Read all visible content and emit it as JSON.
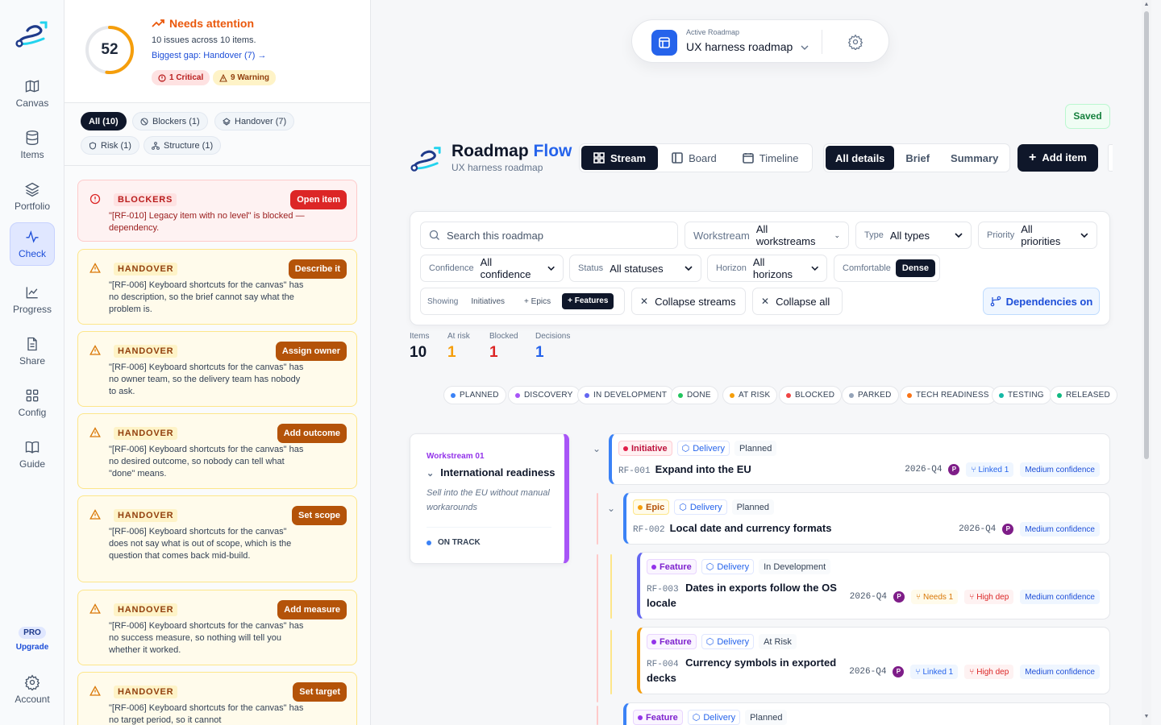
{
  "rail": {
    "items": [
      {
        "label": "Canvas",
        "icon": "map-icon"
      },
      {
        "label": "Items",
        "icon": "database-icon"
      },
      {
        "label": "Portfolio",
        "icon": "layers-icon"
      },
      {
        "label": "Check",
        "icon": "pulse-icon",
        "active": true
      },
      {
        "label": "Progress",
        "icon": "chart-icon"
      },
      {
        "label": "Share",
        "icon": "document-icon"
      },
      {
        "label": "Config",
        "icon": "grid-icon"
      },
      {
        "label": "Guide",
        "icon": "book-icon"
      }
    ],
    "pro_badge": "PRO",
    "upgrade": "Upgrade",
    "account": "Account"
  },
  "check": {
    "score": "52",
    "score_fraction": 0.52,
    "title": "Needs attention",
    "summary": "10 issues across 10 items.",
    "biggest_gap": "Biggest gap: Handover (7) →",
    "critical": "1 Critical",
    "warning": "9 Warning",
    "filters": [
      "All (10)",
      "Blockers (1)",
      "Handover (7)",
      "Risk (1)",
      "Structure (1)"
    ],
    "cards": [
      {
        "type": "BLOCKERS",
        "message": "\"[RF-010] Legacy item with no level\" is blocked — dependency.",
        "action": "Open item"
      },
      {
        "type": "HANDOVER",
        "message": "\"[RF-006] Keyboard shortcuts for the canvas\" has no description, so the brief cannot say what the problem is.",
        "action": "Describe it"
      },
      {
        "type": "HANDOVER",
        "message": "\"[RF-006] Keyboard shortcuts for the canvas\" has no owner team, so the delivery team has nobody to ask.",
        "action": "Assign owner"
      },
      {
        "type": "HANDOVER",
        "message": "\"[RF-006] Keyboard shortcuts for the canvas\" has no desired outcome, so nobody can tell what \"done\" means.",
        "action": "Add outcome"
      },
      {
        "type": "HANDOVER",
        "message": "\"[RF-006] Keyboard shortcuts for the canvas\" does not say what is out of scope, which is the question that comes back mid-build.",
        "action": "Set scope"
      },
      {
        "type": "HANDOVER",
        "message": "\"[RF-006] Keyboard shortcuts for the canvas\" has no success measure, so nothing will tell you whether it worked.",
        "action": "Add measure"
      },
      {
        "type": "HANDOVER",
        "message": "\"[RF-006] Keyboard shortcuts for the canvas\" has no target period, so it cannot",
        "action": "Set target"
      }
    ]
  },
  "switcher": {
    "label": "Active Roadmap",
    "name": "UX harness roadmap"
  },
  "saved": "Saved",
  "brand": {
    "title": "Roadmap",
    "title_accent": "Flow",
    "subtitle": "UX harness roadmap"
  },
  "views": [
    "Stream",
    "Board",
    "Timeline"
  ],
  "detail_modes": [
    "All details",
    "Brief",
    "Summary"
  ],
  "add_item": "Add item",
  "filters": {
    "search_placeholder": "Search this roadmap",
    "workstream": {
      "label": "Workstream",
      "value": "All workstreams"
    },
    "type": {
      "label": "Type",
      "value": "All types"
    },
    "priority": {
      "label": "Priority",
      "value": "All priorities"
    },
    "confidence": {
      "label": "Confidence",
      "value": "All confidence"
    },
    "status": {
      "label": "Status",
      "value": "All statuses"
    },
    "horizon": {
      "label": "Horizon",
      "value": "All horizons"
    },
    "density": [
      "Comfortable",
      "Dense"
    ],
    "showing": {
      "label": "Showing",
      "options": [
        "Initiatives",
        "+ Epics",
        "+ Features"
      ]
    },
    "collapse_streams": "Collapse streams",
    "collapse_all": "Collapse all",
    "dependencies": "Dependencies on"
  },
  "stats": [
    {
      "label": "Items",
      "value": "10",
      "color": "#0f172a"
    },
    {
      "label": "At risk",
      "value": "1",
      "color": "#f59e0b"
    },
    {
      "label": "Blocked",
      "value": "1",
      "color": "#dc2626"
    },
    {
      "label": "Decisions",
      "value": "1",
      "color": "#2563eb"
    }
  ],
  "legend": [
    {
      "label": "PLANNED",
      "color": "#3b82f6"
    },
    {
      "label": "DISCOVERY",
      "color": "#a855f7"
    },
    {
      "label": "IN DEVELOPMENT",
      "color": "#6366f1"
    },
    {
      "label": "DONE",
      "color": "#22c55e"
    },
    {
      "label": "AT RISK",
      "color": "#f59e0b"
    },
    {
      "label": "BLOCKED",
      "color": "#ef4444"
    },
    {
      "label": "PARKED",
      "color": "#94a3b8"
    },
    {
      "label": "TECH READINESS",
      "color": "#f97316"
    },
    {
      "label": "TESTING",
      "color": "#14b8a6"
    },
    {
      "label": "RELEASED",
      "color": "#10b981"
    }
  ],
  "workstream": {
    "label": "Workstream 01",
    "title": "International readiness",
    "description": "Sell into the EU without manual workarounds",
    "status": "ON TRACK"
  },
  "items": [
    {
      "level": "Initiative",
      "workstream": "Delivery",
      "status": "Planned",
      "id": "RF-001",
      "title": "Expand into the EU",
      "quarter": "2026-Q4",
      "owner": "P",
      "links": [
        {
          "text": "Linked 1",
          "tone": "blue"
        }
      ],
      "confidence": "Medium confidence"
    },
    {
      "level": "Epic",
      "workstream": "Delivery",
      "status": "Planned",
      "id": "RF-002",
      "title": "Local date and currency formats",
      "quarter": "2026-Q4",
      "owner": "P",
      "links": [],
      "confidence": "Medium confidence"
    },
    {
      "level": "Feature",
      "workstream": "Delivery",
      "status": "In Development",
      "id": "RF-003",
      "title_1": "Dates in exports follow the OS",
      "title_2": "locale",
      "quarter": "2026-Q4",
      "owner": "P",
      "links": [
        {
          "text": "Needs 1",
          "tone": "amber"
        },
        {
          "text": "High dep",
          "tone": "red"
        }
      ],
      "confidence": "Medium confidence"
    },
    {
      "level": "Feature",
      "workstream": "Delivery",
      "status": "At Risk",
      "id": "RF-004",
      "title_1": "Currency symbols in exported",
      "title_2": "decks",
      "quarter": "2026-Q4",
      "owner": "P",
      "links": [
        {
          "text": "Linked 1",
          "tone": "blue"
        },
        {
          "text": "High dep",
          "tone": "red"
        }
      ],
      "confidence": "Medium confidence"
    },
    {
      "level": "Feature",
      "workstream": "Delivery",
      "status": "Planned"
    }
  ]
}
